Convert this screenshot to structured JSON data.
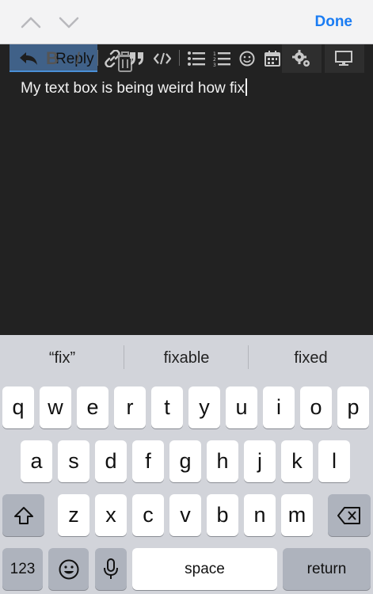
{
  "accessory": {
    "done_label": "Done",
    "prev_icon": "chevron-up-icon",
    "next_icon": "chevron-down-icon"
  },
  "editor": {
    "reply_label": "Reply",
    "text": "My text box is being weird how fix",
    "toolbar_icons": [
      "reply-arrow-icon",
      "bold-icon",
      "italic-icon",
      "trash-icon",
      "link-icon",
      "quote-icon",
      "code-icon",
      "bullet-list-icon",
      "numbered-list-icon",
      "emoji-icon",
      "calendar-icon",
      "settings-icon",
      "desktop-icon"
    ]
  },
  "keyboard": {
    "suggestions": [
      "“fix”",
      "fixable",
      "fixed"
    ],
    "row1": [
      "q",
      "w",
      "e",
      "r",
      "t",
      "y",
      "u",
      "i",
      "o",
      "p"
    ],
    "row2": [
      "a",
      "s",
      "d",
      "f",
      "g",
      "h",
      "j",
      "k",
      "l"
    ],
    "row3": [
      "z",
      "x",
      "c",
      "v",
      "b",
      "n",
      "m"
    ],
    "numbers_label": "123",
    "space_label": "space",
    "return_label": "return"
  },
  "colors": {
    "editor_bg": "#222222",
    "accent": "#1a7cf3",
    "keyboard_bg": "#d2d4da"
  }
}
